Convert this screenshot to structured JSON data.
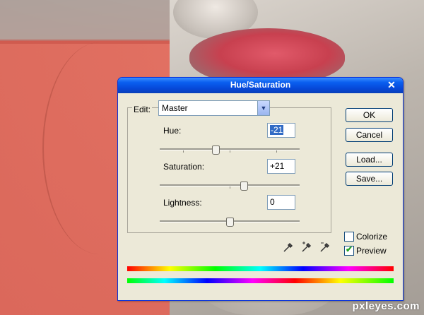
{
  "dialog": {
    "title": "Hue/Saturation",
    "close_glyph": "✕",
    "edit_label": "Edit:",
    "edit_value": "Master",
    "hue": {
      "label": "Hue:",
      "value": "-21",
      "slider_fraction": 0.4
    },
    "saturation": {
      "label": "Saturation:",
      "value": "+21",
      "slider_fraction": 0.6
    },
    "lightness": {
      "label": "Lightness:",
      "value": "0",
      "slider_fraction": 0.5
    },
    "buttons": {
      "ok": "OK",
      "cancel": "Cancel",
      "load": "Load...",
      "save": "Save..."
    },
    "colorize": {
      "label": "Colorize",
      "checked": false
    },
    "preview": {
      "label": "Preview",
      "checked": true
    },
    "icons": [
      "eyedropper-icon",
      "eyedropper-plus-icon",
      "eyedropper-minus-icon"
    ]
  },
  "watermark": "pxleyes.com"
}
